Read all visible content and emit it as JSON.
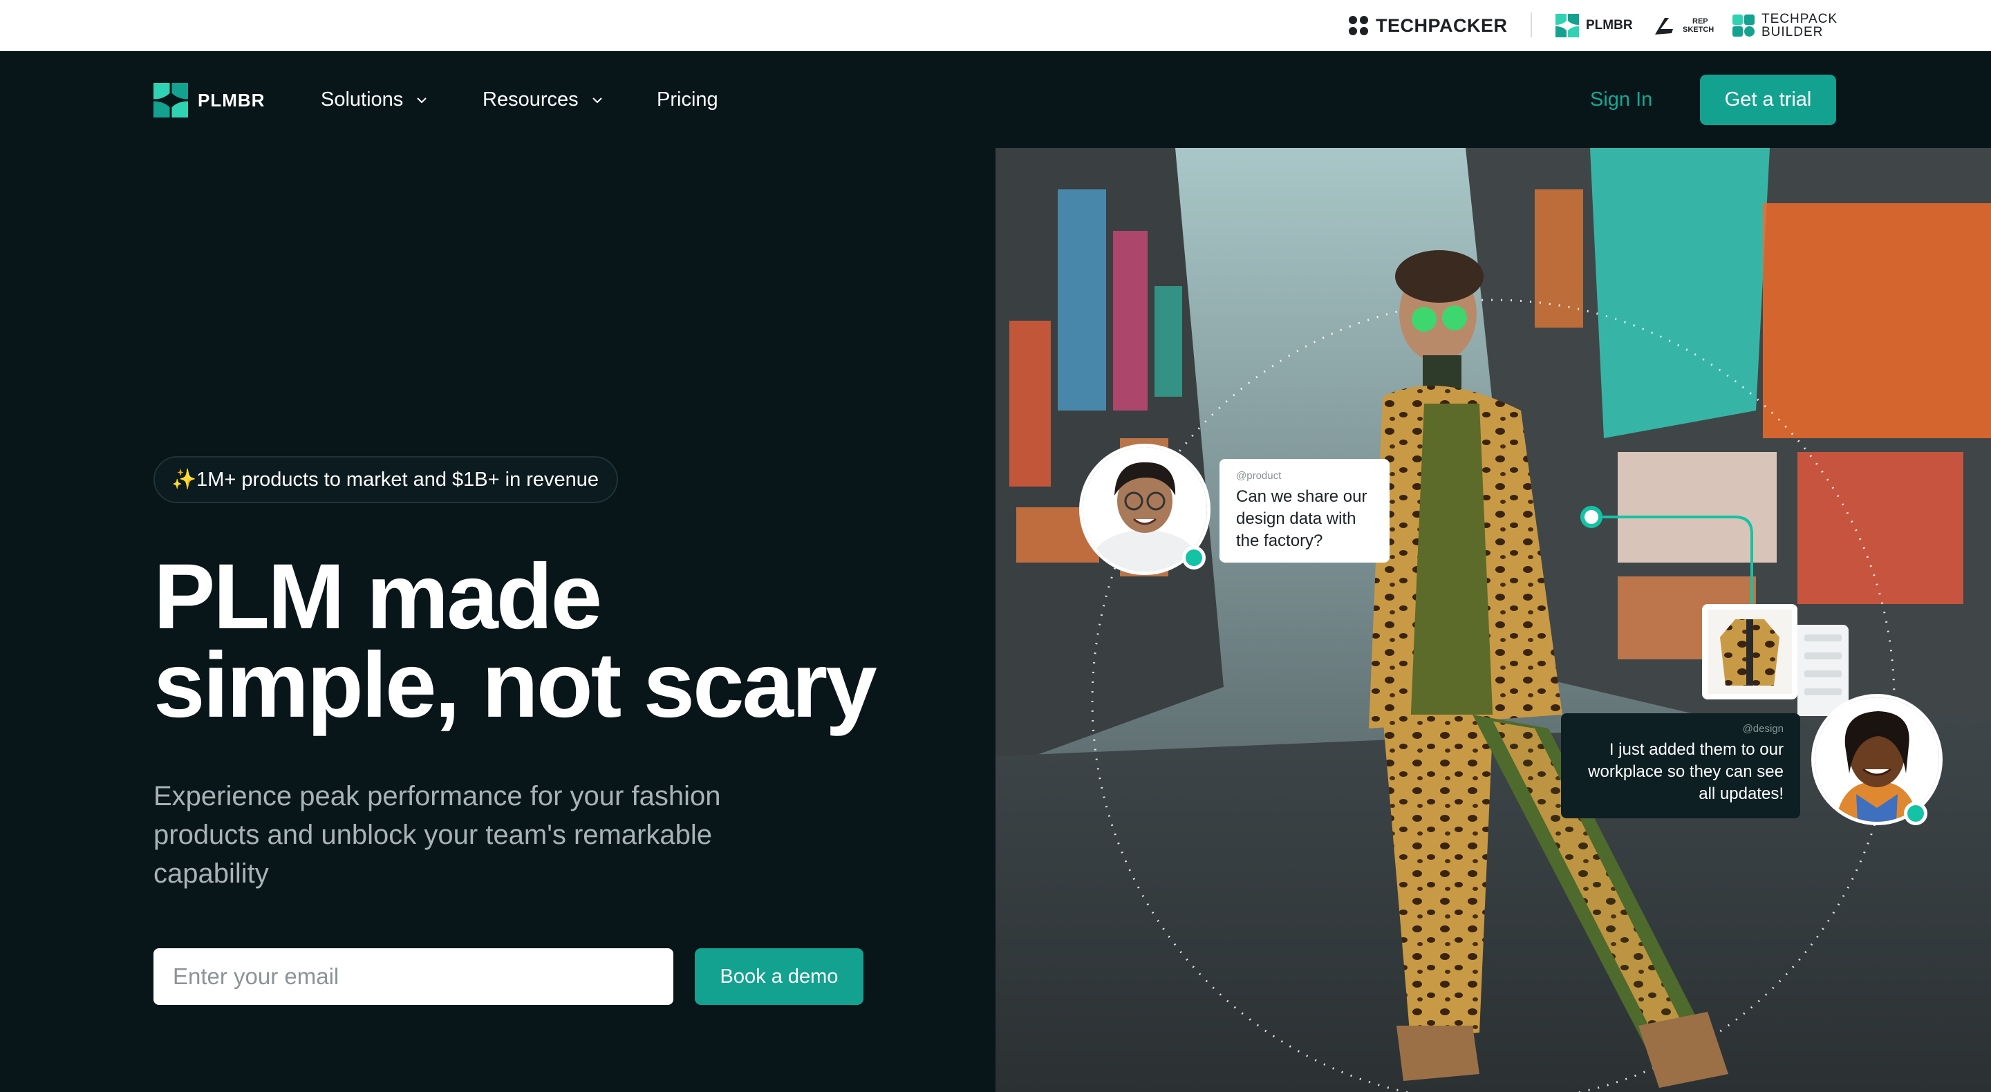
{
  "brand_bar": {
    "techpacker": "TECHPACKER",
    "plmbr": "PLMBR",
    "rep_sketch_top": "REP",
    "rep_sketch_bottom": "SKETCH",
    "techpack_builder_top": "TECHPACK",
    "techpack_builder_bottom": "BUILDER"
  },
  "nav": {
    "logo_text": "PLMBR",
    "items": [
      {
        "label": "Solutions",
        "icon": "chevron-down-icon"
      },
      {
        "label": "Resources",
        "icon": "chevron-down-icon"
      },
      {
        "label": "Pricing"
      }
    ],
    "sign_in": "Sign In",
    "trial_button": "Get a trial"
  },
  "hero": {
    "badge": "✨1M+ products to market and $1B+ in revenue",
    "headline_line1": "PLM made",
    "headline_line2": "simple, not scary",
    "subtext": "Experience peak performance for your fashion products and unblock your team's remarkable capability",
    "email_placeholder": "Enter your email",
    "demo_button": "Book a demo"
  },
  "chat": {
    "product_tag": "@product",
    "product_message": "Can we share our design data with the factory?",
    "design_tag": "@design",
    "design_message": "I just added them to our workplace so they can see all updates!"
  },
  "colors": {
    "accent": "#13a190",
    "background": "#08161a",
    "online_dot": "#14c3a5"
  }
}
